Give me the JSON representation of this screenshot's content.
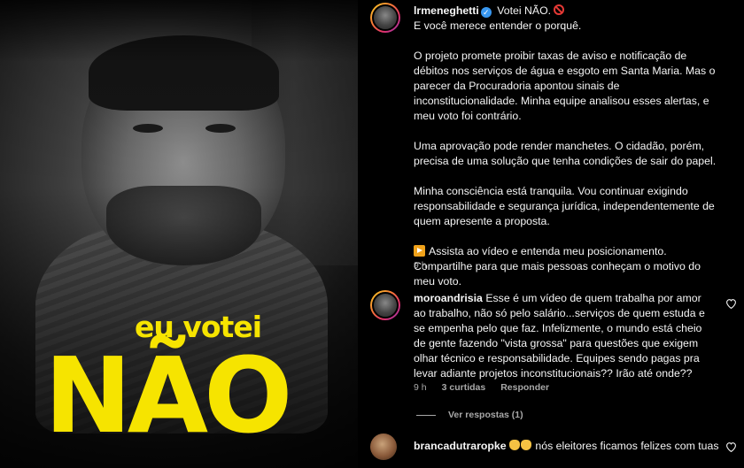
{
  "video": {
    "overlay_line1": "eu votei",
    "overlay_line2": "NÃO",
    "overlay_color": "#f6e400"
  },
  "post": {
    "username": "lrmeneghetti",
    "verified_icon": "verified-badge-icon",
    "title": "Votei NÃO.",
    "title_icon": "no-entry-icon",
    "paragraphs": [
      "E você merece entender o porquê.",
      "O projeto promete proibir taxas de aviso e notificação de débitos nos serviços de água e esgoto em Santa Maria. Mas o parecer da Procuradoria apontou sinais de inconstitucionalidade. Minha equipe analisou esses alertas, e meu voto foi contrário.",
      "Uma aprovação pode render manchetes. O cidadão, porém, precisa de uma solução que tenha condições de sair do papel.",
      "Minha consciência está tranquila. Vou continuar exigindo responsabilidade e segurança jurídica, independentemente de quem apresente a proposta.",
      "Assista ao vídeo e entenda meu posicionamento. Compartilhe para que mais pessoas conheçam o motivo do meu voto."
    ],
    "play_icon": "play-button-icon",
    "time": "9 h"
  },
  "comments": [
    {
      "username": "moroandrisia",
      "text": "Esse é um vídeo de quem trabalha por amor ao trabalho, não só pelo salário...serviços de quem estuda e se empenha pelo que faz. Infelizmente, o mundo está cheio de gente fazendo \"vista grossa\" para questões que exigem olhar técnico e responsabilidade. Equipes sendo pagas pra levar adiante projetos inconstitucionais?? Irão até onde??",
      "time": "9 h",
      "likes": "3 curtidas",
      "reply": "Responder",
      "view_replies": "Ver respostas (1)"
    },
    {
      "username": "brancadutraropke",
      "text": "nós eleitores ficamos felizes com tuas",
      "emoji_icon": "clapping-hands-icon"
    }
  ],
  "colors": {
    "background": "#000000",
    "text": "#f5f5f5",
    "muted": "#a8a8a8",
    "verified": "#3897f0"
  }
}
